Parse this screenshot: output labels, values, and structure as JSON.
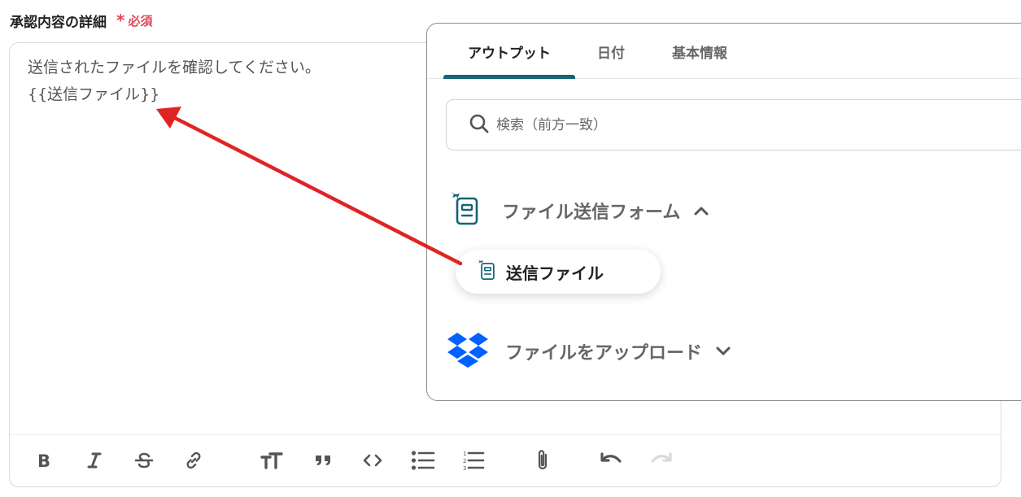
{
  "field": {
    "label": "承認内容の詳細",
    "required_mark": "*",
    "required_text": "必須"
  },
  "editor": {
    "line1": "送信されたファイルを確認してください。",
    "line2": "{{送信ファイル}}"
  },
  "toolbar": {
    "buttons": [
      "bold-icon",
      "italic-icon",
      "strikethrough-icon",
      "link-icon",
      "text-size-icon",
      "quote-icon",
      "code-icon",
      "bullet-list-icon",
      "numbered-list-icon",
      "attachment-icon",
      "undo-icon",
      "redo-icon"
    ]
  },
  "panel": {
    "tabs": [
      {
        "label": "アウトプット",
        "active": true
      },
      {
        "label": "日付",
        "active": false
      },
      {
        "label": "基本情報",
        "active": false
      }
    ],
    "search": {
      "placeholder": "検索（前方一致）"
    },
    "groups": [
      {
        "label": "ファイル送信フォーム",
        "icon": "form-icon",
        "expanded": true,
        "items": [
          {
            "label": "送信ファイル",
            "icon": "form-icon"
          }
        ]
      },
      {
        "label": "ファイルをアップロード",
        "icon": "dropbox-icon",
        "expanded": false
      }
    ]
  },
  "colors": {
    "accent": "#156477",
    "required": "#e2475a",
    "arrow": "#e02424",
    "dropbox": "#0061fe",
    "form_icon": "#156477"
  }
}
